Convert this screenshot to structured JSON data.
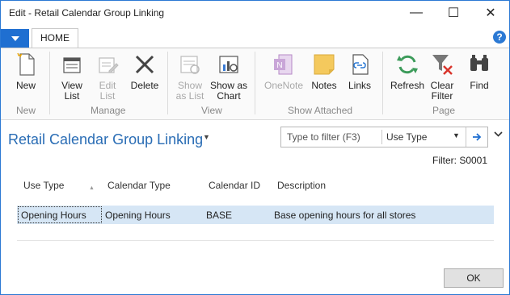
{
  "window": {
    "title": "Edit - Retail Calendar Group Linking"
  },
  "window_controls": {
    "minimize": "—",
    "maximize": "☐",
    "close": "✕"
  },
  "ribbon": {
    "tab": "HOME",
    "help": "?",
    "groups": {
      "new": {
        "label": "New",
        "buttons": [
          {
            "label": "New"
          }
        ]
      },
      "manage": {
        "label": "Manage",
        "buttons": [
          {
            "label": "View\nList"
          },
          {
            "label": "Edit\nList"
          },
          {
            "label": "Delete"
          }
        ]
      },
      "view": {
        "label": "View",
        "buttons": [
          {
            "label": "Show\nas List"
          },
          {
            "label": "Show as\nChart"
          }
        ]
      },
      "show_attached": {
        "label": "Show Attached",
        "buttons": [
          {
            "label": "OneNote"
          },
          {
            "label": "Notes"
          },
          {
            "label": "Links"
          }
        ]
      },
      "page": {
        "label": "Page",
        "buttons": [
          {
            "label": "Refresh"
          },
          {
            "label": "Clear\nFilter"
          },
          {
            "label": "Find"
          }
        ]
      }
    }
  },
  "page": {
    "title": "Retail Calendar Group Linking",
    "filter": {
      "placeholder": "Type to filter (F3)",
      "field": "Use Type"
    },
    "filter_status": "Filter: S0001"
  },
  "table": {
    "columns": [
      "Use Type",
      "Calendar Type",
      "Calendar ID",
      "Description"
    ],
    "rows": [
      {
        "use_type": "Opening Hours",
        "calendar_type": "Opening Hours",
        "calendar_id": "BASE",
        "description": "Base opening hours for all stores"
      }
    ]
  },
  "footer": {
    "ok": "OK"
  },
  "colors": {
    "accent": "#1f6fd1",
    "title": "#2a6db5",
    "row_selected": "#d6e6f5"
  }
}
